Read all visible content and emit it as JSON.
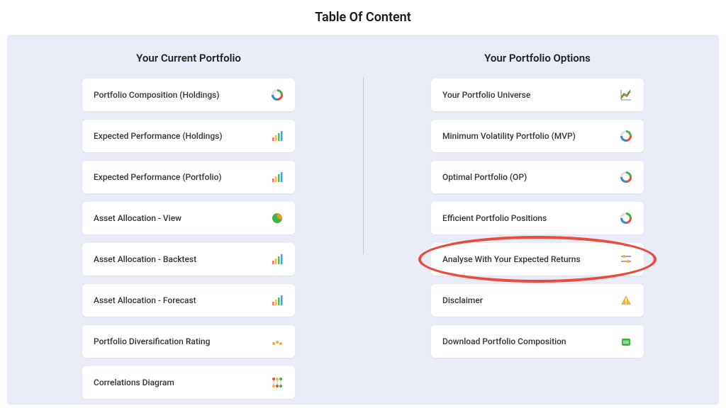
{
  "title": "Table Of Content",
  "left": {
    "heading": "Your Current Portfolio",
    "items": [
      {
        "label": "Portfolio Composition (Holdings)",
        "icon": "donut-chart"
      },
      {
        "label": "Expected Performance (Holdings)",
        "icon": "bars-rising"
      },
      {
        "label": "Expected Performance (Portfolio)",
        "icon": "bars-rising"
      },
      {
        "label": "Asset Allocation - View",
        "icon": "pie-green"
      },
      {
        "label": "Asset Allocation - Backtest",
        "icon": "bars-rising"
      },
      {
        "label": "Asset Allocation - Forecast",
        "icon": "bars-rising"
      },
      {
        "label": "Portfolio Diversification Rating",
        "icon": "dots-yellow"
      },
      {
        "label": "Correlations Diagram",
        "icon": "network-dots"
      }
    ]
  },
  "right": {
    "heading": "Your Portfolio Options",
    "items": [
      {
        "label": "Your Portfolio Universe",
        "icon": "line-chart"
      },
      {
        "label": "Minimum Volatility Portfolio (MVP)",
        "icon": "donut-chart"
      },
      {
        "label": "Optimal Portfolio (OP)",
        "icon": "donut-chart"
      },
      {
        "label": "Efficient Portfolio Positions",
        "icon": "donut-chart"
      },
      {
        "label": "Analyse With Your Expected Returns",
        "icon": "sliders"
      },
      {
        "label": "Disclaimer",
        "icon": "warning"
      },
      {
        "label": "Download Portfolio Composition",
        "icon": "download-green"
      }
    ]
  },
  "highlightIndexRight": 4
}
